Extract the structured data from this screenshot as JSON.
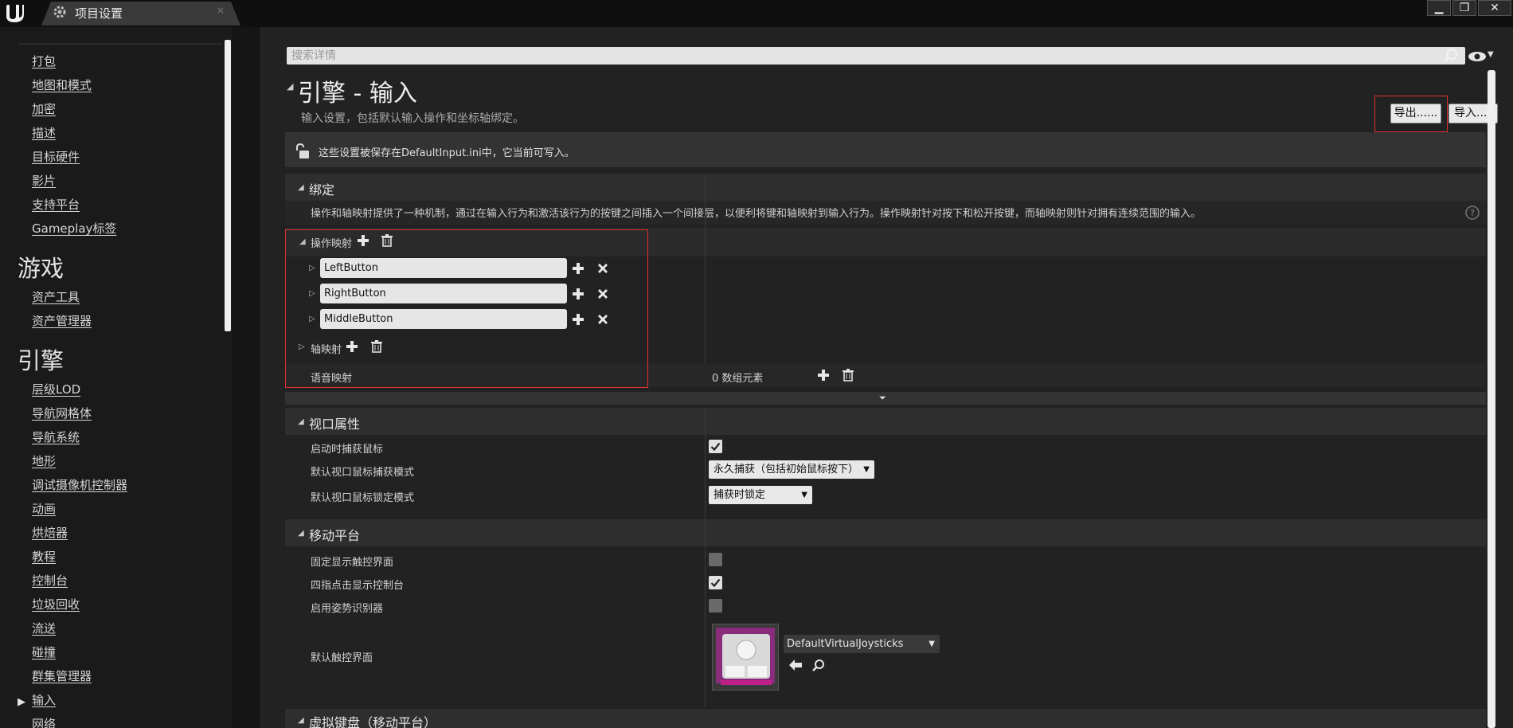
{
  "titlebar": {
    "tab_title": "项目设置",
    "tab_close": "×",
    "win_min": "▁",
    "win_restore": "❐",
    "win_close": "✕"
  },
  "sidebar": {
    "items_top": [
      "打包",
      "地图和模式",
      "加密",
      "描述",
      "目标硬件",
      "影片",
      "支持平台",
      "Gameplay标签"
    ],
    "section_game": "游戏",
    "items_game": [
      "资产工具",
      "资产管理器"
    ],
    "section_engine": "引擎",
    "items_engine": [
      "层级LOD",
      "导航网格体",
      "导航系统",
      "地形",
      "调试摄像机控制器",
      "动画",
      "烘焙器",
      "教程",
      "控制台",
      "垃圾回收",
      "流送",
      "碰撞",
      "群集管理器",
      "输入",
      "网络"
    ]
  },
  "search": {
    "placeholder": "搜索详情"
  },
  "header": {
    "title": "引擎 - 输入",
    "subtitle": "输入设置，包括默认输入操作和坐标轴绑定。",
    "export_label": "导出......",
    "import_label": "导入..."
  },
  "notice": {
    "text": "这些设置被保存在DefaultInput.ini中，它当前可写入。"
  },
  "bindings": {
    "title": "绑定",
    "description": "操作和轴映射提供了一种机制，通过在输入行为和激活该行为的按键之间插入一个间接层，以便利将键和轴映射到输入行为。操作映射针对按下和松开按键，而轴映射则针对拥有连续范围的输入。",
    "action_mappings_label": "操作映射",
    "action_mappings": [
      "LeftButton",
      "RightButton",
      "MiddleButton"
    ],
    "axis_mappings_label": "轴映射",
    "speech_mappings_label": "语音映射",
    "speech_mappings_value": "0 数组元素"
  },
  "viewport": {
    "title": "视口属性",
    "capture_on_start_label": "启动时捕获鼠标",
    "capture_on_start": true,
    "capture_mode_label": "默认视口鼠标捕获模式",
    "capture_mode_value": "永久捕获（包括初始鼠标按下）",
    "lock_mode_label": "默认视口鼠标锁定模式",
    "lock_mode_value": "捕获时锁定"
  },
  "mobile": {
    "title": "移动平台",
    "always_show_touch_label": "固定显示触控界面",
    "always_show_touch": false,
    "four_finger_console_label": "四指点击显示控制台",
    "four_finger_console": true,
    "gesture_label": "启用姿势识别器",
    "gesture": false,
    "default_touch_label": "默认触控界面",
    "default_touch_value": "DefaultVirtualJoysticks"
  },
  "virtual_keyboard": {
    "title": "虚拟键盘（移动平台）"
  },
  "colors": {
    "highlight_red": "#e03030",
    "asset_purple": "#8a2c7c"
  }
}
